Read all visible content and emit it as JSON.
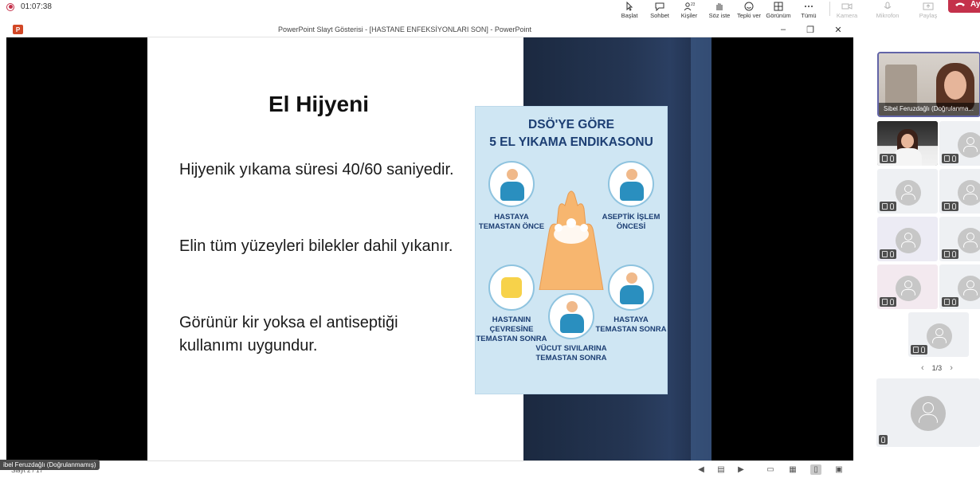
{
  "meeting": {
    "recording_time": "01:07:38",
    "toolbar": [
      {
        "key": "baslat",
        "label": "Başlat"
      },
      {
        "key": "sohbet",
        "label": "Sohbet"
      },
      {
        "key": "kisiler",
        "label": "Kişiler",
        "count": "23"
      },
      {
        "key": "soz",
        "label": "Söz iste"
      },
      {
        "key": "tepki",
        "label": "Tepki ver"
      },
      {
        "key": "gorunum",
        "label": "Görünüm"
      },
      {
        "key": "tumu",
        "label": "Tümü"
      },
      {
        "key": "kamera",
        "label": "Kamera"
      },
      {
        "key": "mikrofon",
        "label": "Mikrofon"
      },
      {
        "key": "paylas",
        "label": "Paylaş"
      }
    ],
    "leave_label": "Ay"
  },
  "ppt": {
    "window_title": "PowerPoint Slayt Gösterisi - [HASTANE ENFEKSİYONLARI SON] - PowerPoint",
    "slide": {
      "title": "El Hijyeni",
      "bullets": [
        "Hijyenik yıkama süresi 40/60 saniyedir.",
        "Elin tüm yüzeyleri bilekler dahil yıkanır.",
        "Görünür kir yoksa el antiseptiği kullanımı uygundur."
      ],
      "poster": {
        "title_line1": "DSÖ'YE GÖRE",
        "title_line2": "5 EL YIKAMA ENDIKASONU",
        "labels": [
          "HASTAYA TEMASTAN ÖNCE",
          "ASEPTİK İŞLEM ÖNCESİ",
          "HASTANIN ÇEVRESİNE TEMASTAN SONRA",
          "VÜCUT SIVILARINA TEMASTAN SONRA",
          "HASTAYA TEMASTAN SONRA"
        ]
      }
    },
    "status": {
      "slide_counter": "Slayt 2 / 17"
    }
  },
  "participants": {
    "main_speaker_name": "Sibel Feruzdağlı (Doğrulanma...",
    "presenter_tag": "ibel Feruzdağlı (Doğrulanmamış)",
    "pager": "1/3"
  },
  "colors": {
    "accent": "#6264a7",
    "leave": "#c4314b",
    "poster_bg": "#cfe6f3",
    "poster_text": "#1c3e73"
  }
}
